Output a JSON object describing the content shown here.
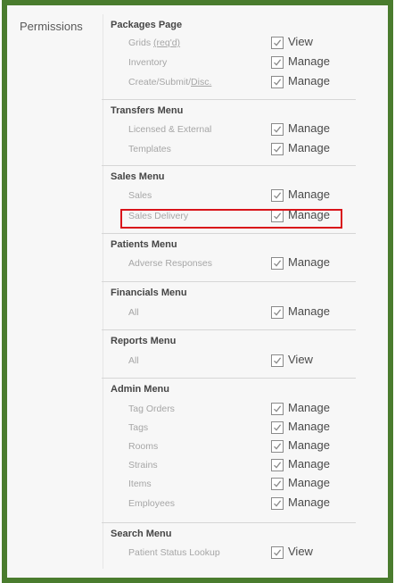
{
  "permissions_label": "Permissions",
  "sections": [
    {
      "title": "Packages Page",
      "rows": [
        {
          "label": "Grids ",
          "label_link": "(req'd)",
          "action": "View"
        },
        {
          "label": "Inventory",
          "action": "Manage"
        },
        {
          "label": "Create/Submit/",
          "label_link": "Disc.",
          "action": "Manage"
        }
      ]
    },
    {
      "title": "Transfers Menu",
      "rows": [
        {
          "label": "Licensed & External",
          "action": "Manage"
        },
        {
          "label": "Templates",
          "action": "Manage"
        }
      ]
    },
    {
      "title": "Sales Menu",
      "rows": [
        {
          "label": "Sales",
          "action": "Manage"
        },
        {
          "label": "Sales Delivery",
          "action": "Manage"
        }
      ]
    },
    {
      "title": "Patients Menu",
      "rows": [
        {
          "label": "Adverse Responses",
          "action": "Manage"
        }
      ]
    },
    {
      "title": "Financials Menu",
      "rows": [
        {
          "label": "All",
          "action": "Manage"
        }
      ]
    },
    {
      "title": "Reports Menu",
      "rows": [
        {
          "label": "All",
          "action": "View"
        }
      ]
    },
    {
      "title": "Admin Menu",
      "rows": [
        {
          "label": "Tag Orders",
          "action": "Manage"
        },
        {
          "label": "Tags",
          "action": "Manage"
        },
        {
          "label": "Rooms",
          "action": "Manage"
        },
        {
          "label": "Strains",
          "action": "Manage"
        },
        {
          "label": "Items",
          "action": "Manage"
        },
        {
          "label": "Employees",
          "action": "Manage"
        }
      ]
    },
    {
      "title": "Search Menu",
      "rows": [
        {
          "label": "Patient Status Lookup",
          "action": "View"
        }
      ]
    }
  ]
}
